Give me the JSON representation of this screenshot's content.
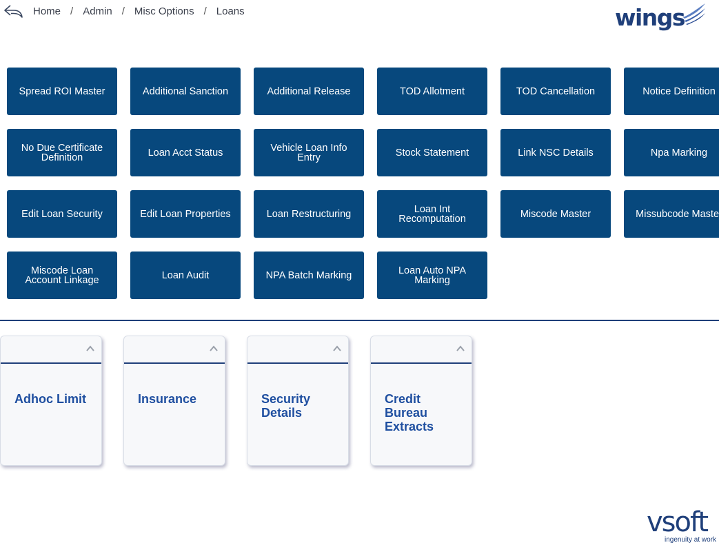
{
  "breadcrumb": {
    "items": [
      "Home",
      "Admin",
      "Misc Options",
      "Loans"
    ],
    "separator": "/"
  },
  "brand": {
    "app_logo": "wings",
    "vendor_logo": "vsoft",
    "vendor_tagline": "ingenuity at work"
  },
  "tiles": [
    "Spread ROI Master",
    "Additional Sanction",
    "Additional Release",
    "TOD Allotment",
    "TOD Cancellation",
    "Notice Definition",
    "No Due Certificate Definition",
    "Loan Acct Status",
    "Vehicle Loan Info Entry",
    "Stock Statement",
    "Link NSC Details",
    "Npa Marking",
    "Edit Loan Security",
    "Edit Loan Properties",
    "Loan Restructuring",
    "Loan Int Recomputation",
    "Miscode Master",
    "Missubcode Master",
    "Miscode Loan Account Linkage",
    "Loan Audit",
    "NPA Batch Marking",
    "Loan Auto NPA Marking"
  ],
  "cards": [
    "Adhoc Limit",
    "Insurance",
    "Security Details",
    "Credit Bureau Extracts"
  ],
  "colors": {
    "tile_bg": "#07487d",
    "accent": "#1f3f7a",
    "card_title": "#1f4fa0"
  },
  "icons": {
    "back": "back-arrow-icon",
    "collapse": "chevron-up-icon"
  }
}
